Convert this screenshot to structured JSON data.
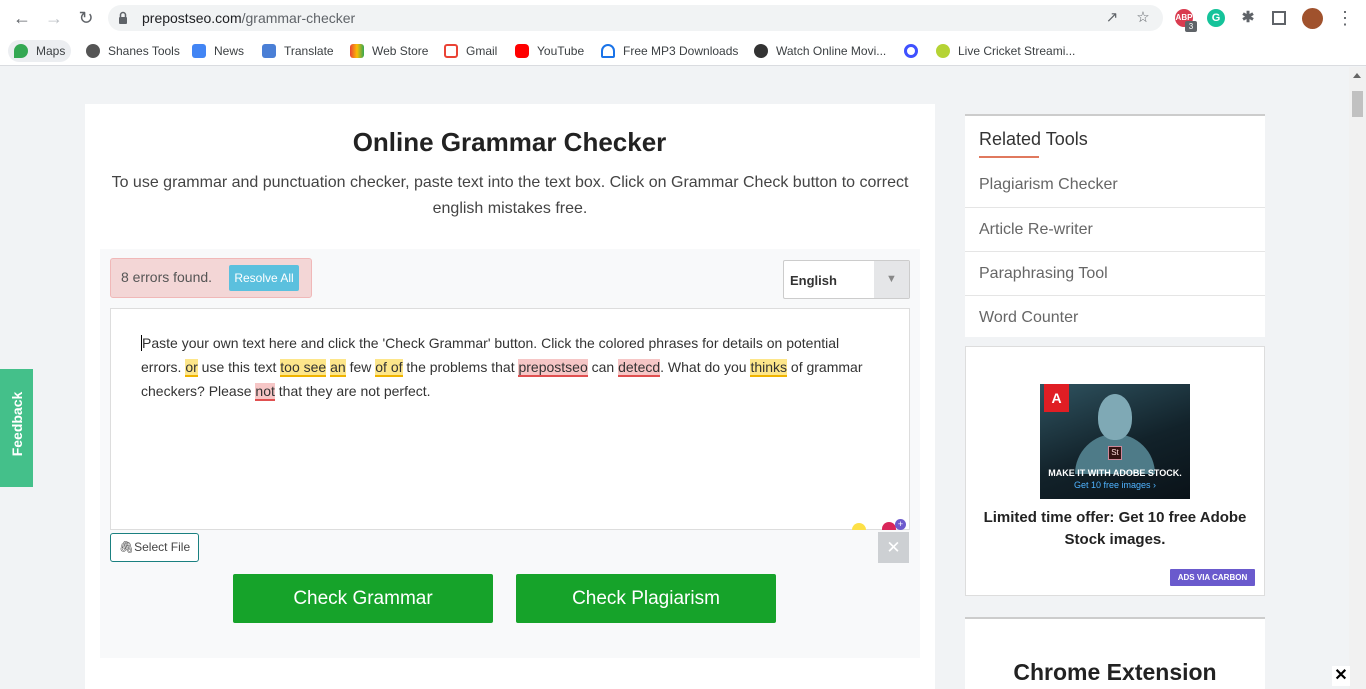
{
  "browser": {
    "url_domain": "prepostseo.com",
    "url_path": "/grammar-checker",
    "extension_badge": "3",
    "bookmarks": [
      "Maps",
      "Shanes Tools",
      "News",
      "Translate",
      "Web Store",
      "Gmail",
      "YouTube",
      "Free MP3 Downloads",
      "Watch Online Movi...",
      "Live Cricket Streami..."
    ]
  },
  "page": {
    "title": "Online Grammar Checker",
    "description": "To use grammar and punctuation checker, paste text into the text box. Click on Grammar Check button to correct english mistakes free."
  },
  "checker": {
    "errors_text": "8 errors found.",
    "resolve_label": "Resolve All",
    "language": "English",
    "text_parts": {
      "p1": "Paste your own text here and click the 'Check Grammar' button. Click the colored phrases for details on potential errors. ",
      "e1": "or",
      "p2": " use this text ",
      "e2": "too see",
      "p3": " ",
      "e3": "an",
      "p4": " few ",
      "e4": "of of",
      "p5": " the problems that ",
      "e5": "prepostseo",
      "p6": " can ",
      "e6": "detecd",
      "p7": ". What do you ",
      "e7": "thinks",
      "p8": " of grammar checkers? Please ",
      "e8": "not",
      "p9": " that they are not perfect."
    },
    "select_file_label": "Select File",
    "check_grammar_label": "Check Grammar",
    "check_plagiarism_label": "Check Plagiarism"
  },
  "sidebar": {
    "related_title": "Related Tools",
    "related_items": [
      "Plagiarism Checker",
      "Article Re-writer",
      "Paraphrasing Tool",
      "Word Counter"
    ],
    "ad": {
      "image_line1": "MAKE IT WITH ADOBE STOCK.",
      "image_line2": "Get 10 free images ›",
      "text": "Limited time offer: Get 10 free Adobe Stock images.",
      "badge": "ADS VIA CARBON"
    },
    "extension_title": "Chrome Extension"
  },
  "feedback_label": "Feedback",
  "colors": {
    "primary_green": "#16a32a",
    "feedback_green": "#44c08a",
    "resolve_blue": "#5bc0de",
    "error_yellow": "#fde68a",
    "error_red": "#f6c6c6"
  }
}
